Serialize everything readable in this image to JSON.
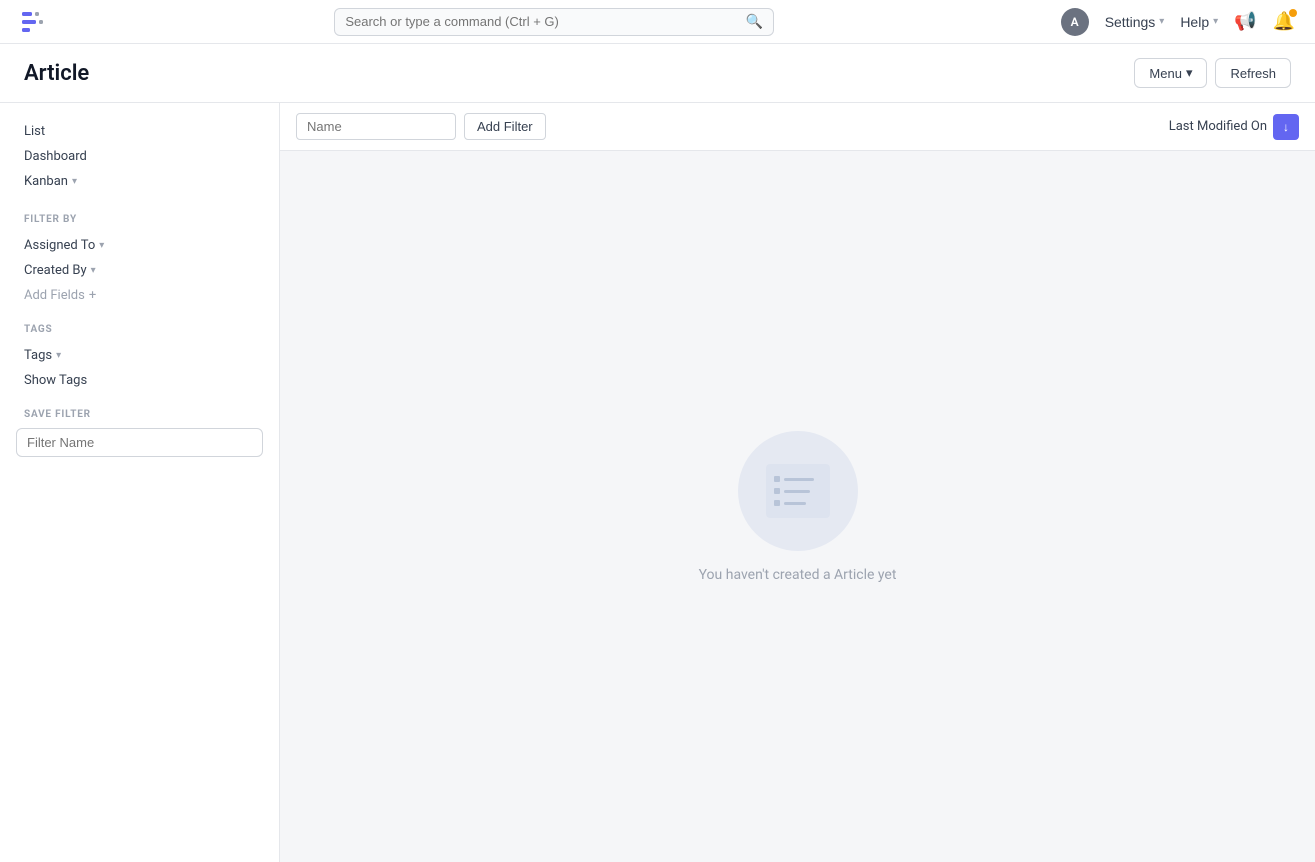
{
  "topnav": {
    "search_placeholder": "Search or type a command (Ctrl + G)",
    "settings_label": "Settings",
    "help_label": "Help",
    "avatar_letter": "A"
  },
  "page": {
    "title": "Article",
    "menu_label": "Menu",
    "refresh_label": "Refresh"
  },
  "sidebar": {
    "list_label": "List",
    "dashboard_label": "Dashboard",
    "kanban_label": "Kanban",
    "filter_by_label": "FILTER BY",
    "assigned_to_label": "Assigned To",
    "created_by_label": "Created By",
    "add_fields_label": "Add Fields",
    "tags_label": "TAGS",
    "tags_dropdown_label": "Tags",
    "show_tags_label": "Show Tags",
    "save_filter_label": "SAVE FILTER",
    "filter_name_placeholder": "Filter Name"
  },
  "main": {
    "name_placeholder": "Name",
    "add_filter_label": "Add Filter",
    "last_modified_label": "Last Modified On",
    "empty_text": "You haven't created a Article yet"
  }
}
